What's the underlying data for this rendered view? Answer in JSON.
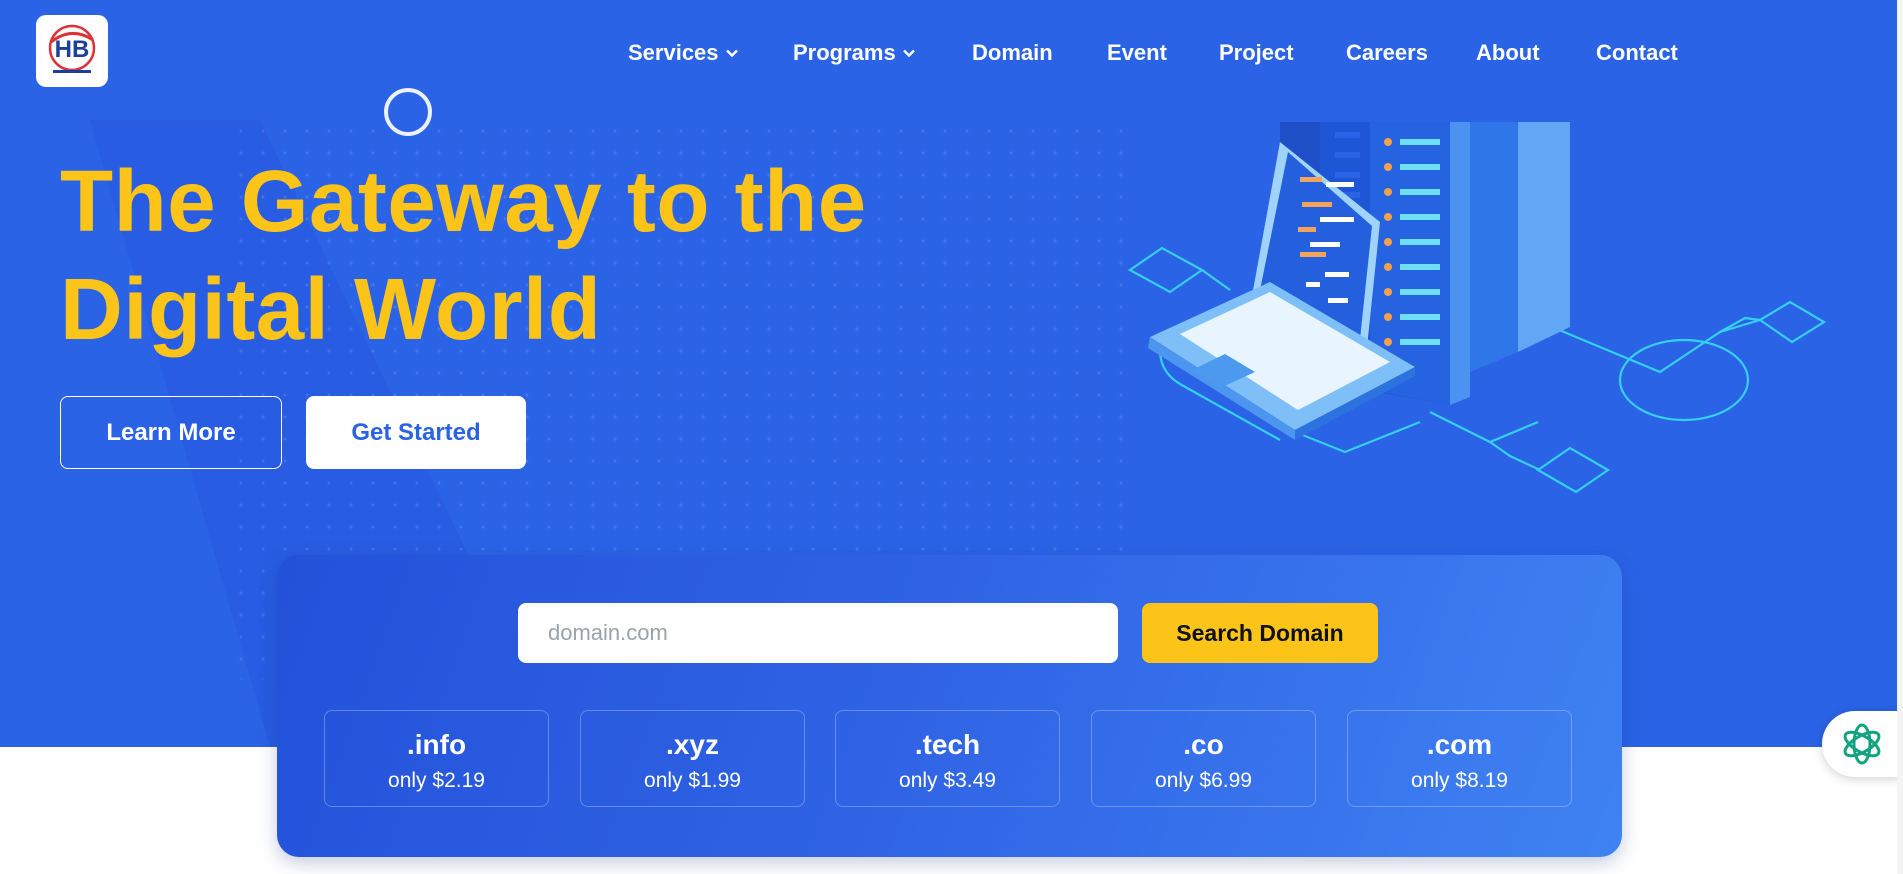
{
  "header": {
    "logo_alt": "HB",
    "nav": [
      {
        "label": "Services",
        "dropdown": true
      },
      {
        "label": "Programs",
        "dropdown": true
      },
      {
        "label": "Domain",
        "dropdown": false
      },
      {
        "label": "Event",
        "dropdown": false
      },
      {
        "label": "Project",
        "dropdown": false
      },
      {
        "label": "Careers",
        "dropdown": false
      },
      {
        "label": "About",
        "dropdown": false
      },
      {
        "label": "Contact",
        "dropdown": false
      }
    ]
  },
  "hero": {
    "headline_line1": "The Gateway to the",
    "headline_line2": "Digital World",
    "learn_more_label": "Learn More",
    "get_started_label": "Get Started"
  },
  "domain_search": {
    "placeholder": "domain.com",
    "value": "",
    "button_label": "Search Domain",
    "tlds": [
      {
        "name": ".info",
        "price": "only $2.19"
      },
      {
        "name": ".xyz",
        "price": "only $1.99"
      },
      {
        "name": ".tech",
        "price": "only $3.49"
      },
      {
        "name": ".co",
        "price": "only $6.99"
      },
      {
        "name": ".com",
        "price": "only $8.19"
      }
    ]
  },
  "icons": {
    "dropdown": "chevron-down-icon",
    "chat": "openai-chat-icon",
    "hero": "server-laptop-illustration"
  },
  "colors": {
    "hero_bg": "#2a63e6",
    "accent_yellow": "#fcc419",
    "white": "#ffffff"
  }
}
